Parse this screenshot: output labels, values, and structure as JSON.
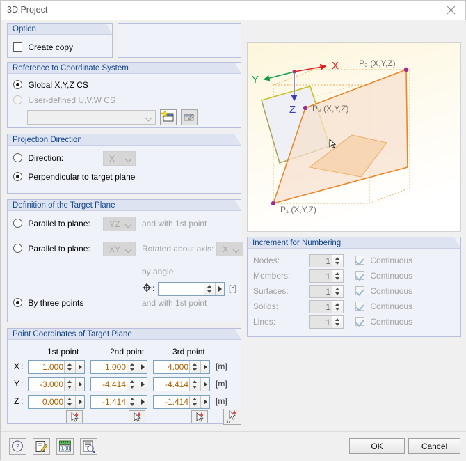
{
  "window": {
    "title": "3D Project",
    "close_icon": "close-icon"
  },
  "option_group": {
    "title": "Option",
    "create_copy_label": "Create copy",
    "create_copy_checked": false
  },
  "reference_group": {
    "title": "Reference to Coordinate System",
    "global_label": "Global X,Y,Z CS",
    "global_selected": true,
    "user_defined_label": "User-defined U,V,W CS",
    "user_defined_selected": false,
    "cs_combo_value": "",
    "new_cs_icon": "new-coordinate-system-icon",
    "edit_cs_icon": "edit-coordinate-system-icon"
  },
  "projection_group": {
    "title": "Projection Direction",
    "direction_label": "Direction:",
    "direction_selected": false,
    "direction_value": "X",
    "perpendicular_label": "Perpendicular to target plane",
    "perpendicular_selected": true
  },
  "target_plane_group": {
    "title": "Definition of the Target Plane",
    "parallel1_label": "Parallel to plane:",
    "parallel1_selected": false,
    "parallel1_value": "YZ",
    "parallel1_suffix": "and with 1st point",
    "parallel2_label": "Parallel to plane:",
    "parallel2_selected": false,
    "parallel2_value": "XY",
    "rotated_label": "Rotated about axis:",
    "rotated_value": "X",
    "by_angle_label": "by angle",
    "angle_symbol": "Φ",
    "angle_separator": ":",
    "angle_value": "",
    "angle_unit": "[°]",
    "and_with_1st_point": "and with 1st point",
    "three_points_label": "By three points",
    "three_points_selected": true
  },
  "coordinates_group": {
    "title": "Point Coordinates of Target Plane",
    "columns": [
      "1st point",
      "2nd point",
      "3rd point"
    ],
    "rows": [
      {
        "axis": "X",
        "separator": ":",
        "values": [
          "1.000",
          "1.000",
          "4.000"
        ],
        "unit": "[m]"
      },
      {
        "axis": "Y",
        "separator": ":",
        "values": [
          "-3.000",
          "-4.414",
          "-4.414"
        ],
        "unit": "[m]"
      },
      {
        "axis": "Z",
        "separator": ":",
        "values": [
          "0.000",
          "-1.414",
          "-1.414"
        ],
        "unit": "[m]"
      }
    ],
    "pick_icons": [
      "pick-point-1-icon",
      "pick-point-2-icon",
      "pick-point-3-icon",
      "pick-three-points-icon"
    ]
  },
  "increment_group": {
    "title": "Increment for Numbering",
    "continuous_label": "Continuous",
    "rows": [
      {
        "label": "Nodes:",
        "value": "1",
        "continuous": true
      },
      {
        "label": "Members:",
        "value": "1",
        "continuous": true
      },
      {
        "label": "Surfaces:",
        "value": "1",
        "continuous": true
      },
      {
        "label": "Solids:",
        "value": "1",
        "continuous": true
      },
      {
        "label": "Lines:",
        "value": "1",
        "continuous": true
      }
    ]
  },
  "graphic": {
    "axis_x_label": "X",
    "axis_y_label": "Y",
    "axis_z_label": "Z",
    "axis_x_color": "#e02020",
    "axis_y_color": "#0f9c43",
    "axis_z_color": "#3b3bb0",
    "point_labels": [
      "P₁ (X,Y,Z)",
      "P₂ (X,Y,Z)",
      "P₃ (X,Y,Z)"
    ],
    "source_plane_color": "#c8c020",
    "target_plane_color": "#e8872a",
    "node_color": "#9b2d8e",
    "background_color": "#fefbea"
  },
  "bottom_bar": {
    "icons": [
      "help-icon",
      "edit-icon",
      "units-icon",
      "report-icon"
    ],
    "ok_label": "OK",
    "cancel_label": "Cancel"
  }
}
